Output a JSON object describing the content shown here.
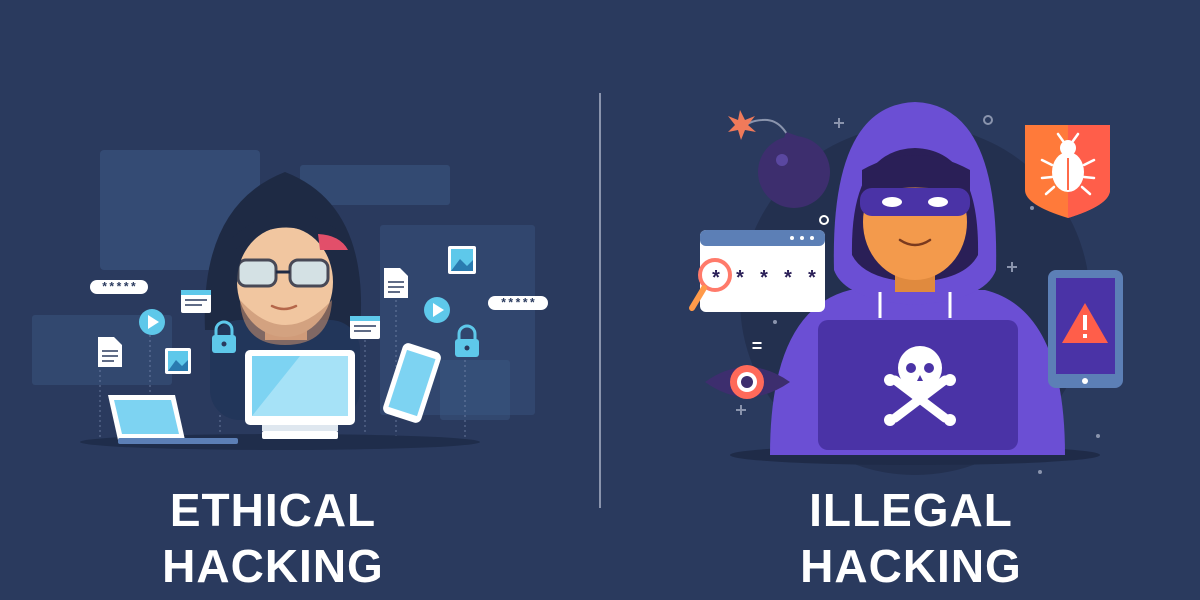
{
  "left": {
    "caption_line1": "ETHICAL",
    "caption_line2": "HACKING",
    "password_mask_1": "*****",
    "password_mask_2": "*****"
  },
  "right": {
    "caption_line1": "ILLEGAL",
    "caption_line2": "HACKING",
    "password_mask": "* * * * *",
    "equals_sign": "="
  },
  "colors": {
    "background": "#2a3a5e",
    "hood": "#6b4fd4",
    "skin": "#f39a4c",
    "screen": "#5ec8ea",
    "warning": "#ff5e4a"
  },
  "icons": [
    "hacker-figure",
    "developer-figure",
    "laptop-icon",
    "monitor-icon",
    "phone-icon",
    "lock-icon",
    "play-icon",
    "document-icon",
    "image-icon",
    "bomb-icon",
    "skull-crossbones-icon",
    "bug-shield-icon",
    "warning-phone-icon",
    "eye-icon",
    "magnifier-icon"
  ]
}
